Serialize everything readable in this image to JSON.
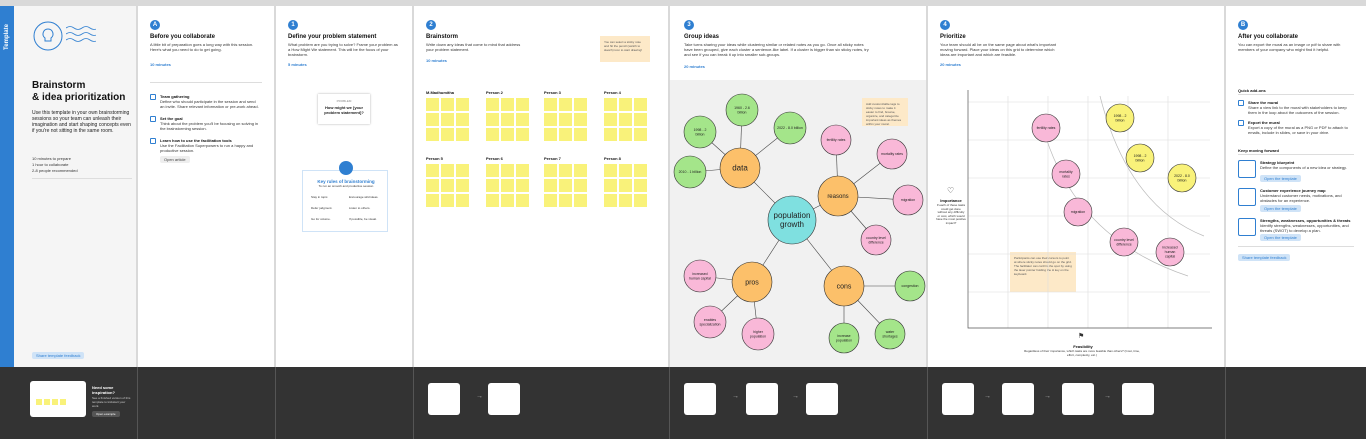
{
  "template_tab": "Template",
  "intro": {
    "title_line1": "Brainstorm",
    "title_line2": "& idea prioritization",
    "description": "Use this template in your own brainstorming sessions so your team can unleash their imagination and start shaping concepts even if you're not sitting in the same room.",
    "stats": [
      "10 minutes to prepare",
      "1 hour to collaborate",
      "2-8 people recommended"
    ],
    "feedback": "Share template feedback"
  },
  "before": {
    "step": "A",
    "title": "Before you collaborate",
    "text": "A little bit of preparation goes a long way with this session. Here's what you need to do to get going.",
    "time": "10 minutes",
    "items": [
      {
        "title": "Team gathering",
        "text": "Define who should participate in the session and send an invite. Share relevant information or pre-work ahead."
      },
      {
        "title": "Set the goal",
        "text": "Think about the problem you'll be focusing on solving in the brainstorming session."
      },
      {
        "title": "Learn how to use the facilitation tools",
        "text": "Use the Facilitation Superpowers to run a happy and productive session."
      }
    ],
    "open_article": "Open article"
  },
  "define": {
    "step": "1",
    "title": "Define your problem statement",
    "text": "What problem are you trying to solve? Frame your problem as a How Might We statement. This will be the focus of your brainstorm.",
    "time": "5 minutes",
    "card_label": "PROBLEM",
    "card_text": "How might we [your problem statement]?",
    "rules_title": "Key rules of brainstorming",
    "rules_sub": "To run an smooth and productive session",
    "rules": [
      "Stay in topic.",
      "Encourage wild ideas.",
      "Defer judgment.",
      "Listen to others.",
      "Go for volume.",
      "If possible, be visual."
    ]
  },
  "brainstorm": {
    "step": "2",
    "title": "Brainstorm",
    "text": "Write down any ideas that come to mind that address your problem statement.",
    "time": "10 minutes",
    "tip": "You can select a sticky note and hit the pencil (switch to sketch) icon to start drawing!",
    "people": [
      "M.Madhumitha",
      "Person 2",
      "Person 3",
      "Person 4",
      "Person 5",
      "Person 6",
      "Person 7",
      "Person 8"
    ]
  },
  "group": {
    "step": "3",
    "title": "Group ideas",
    "text": "Take turns sharing your ideas while clustering similar or related notes as you go. Once all sticky notes have been grouped, give each cluster a sentence-like label. If a cluster is bigger than six sticky notes, try and see if you can break it up into smaller sub-groups.",
    "time": "20 minutes",
    "tip": "Add customizable tags to sticky notes to make it easier to find, browse, organize, and categorize important ideas as themes within your mural.",
    "center": [
      "population",
      "growth"
    ],
    "clusters": {
      "data": "data",
      "reasons": "reasons",
      "pros": "pros",
      "cons": "cons"
    },
    "data_items": [
      [
        "1998 - 2",
        "billion"
      ],
      [
        "1960 - 2.6",
        "billion"
      ],
      [
        "2022 - 8.0 billion"
      ],
      [
        "2010 - 1 billion"
      ]
    ],
    "reason_items": [
      [
        "fertility rates"
      ],
      [
        "mortality rates"
      ],
      [
        "migration"
      ],
      [
        "country level",
        "difference"
      ]
    ],
    "pro_items": [
      [
        "increased",
        "human capital"
      ],
      [
        "enables",
        "specialization"
      ],
      [
        "higher",
        "population"
      ]
    ],
    "con_items": [
      [
        "congestion"
      ],
      [
        "water",
        "shortages"
      ],
      [
        "increase",
        "population"
      ]
    ]
  },
  "prioritize": {
    "step": "4",
    "title": "Prioritize",
    "text": "Your team should all be on the same page about what's important moving forward. Place your ideas on this grid to determine which ideas are important and which are feasible.",
    "time": "20 minutes",
    "y_label": "Importance",
    "y_text": "If each of these tasks could get done without any difficulty or cost, which would have the most positive impact?",
    "x_label": "Feasibility",
    "x_text": "Regardless of their importance, which tasks are more feasible than others? (Cost, time, effort, complexity, etc.)",
    "tip": "Participants can use their cursors to point at where sticky notes should go on the grid. The facilitator can confirm the spot by using the laser pointer holding the H key on the keyboard.",
    "items": [
      [
        "fertility rates"
      ],
      [
        "1998 - 2",
        "billion"
      ],
      [
        "mortality",
        "rates"
      ],
      [
        "1998 - 2",
        "billion"
      ],
      [
        "2022 - 8.0",
        "billion"
      ],
      [
        "migration"
      ],
      [
        "country level",
        "difference"
      ],
      [
        "increased",
        "human",
        "capital"
      ]
    ]
  },
  "after": {
    "title": "After you collaborate",
    "text": "You can export the mural as an image or pdf to share with members of your company who might find it helpful.",
    "quick_title": "Quick add-ons",
    "quick": [
      {
        "title": "Share the mural",
        "text": "Share a view link to the mural with stakeholders to keep them in the loop about the outcomes of the session."
      },
      {
        "title": "Export the mural",
        "text": "Export a copy of the mural as a PNG or PDF to attach to emails, include in slides, or save in your drive."
      }
    ],
    "keep_title": "Keep moving forward",
    "keep": [
      {
        "title": "Strategy blueprint",
        "text": "Define the components of a new idea or strategy.",
        "link": "Open the template"
      },
      {
        "title": "Customer experience journey map",
        "text": "Understand customer needs, motivations, and obstacles for an experience.",
        "link": "Open the template"
      },
      {
        "title": "Strengths, weaknesses, opportunities & threats",
        "text": "Identify strengths, weaknesses, opportunities, and threats (SWOT) to develop a plan.",
        "link": "Open the template"
      }
    ],
    "feedback": "Share template feedback"
  },
  "bottom": {
    "inspired_title": "Need some inspiration?",
    "inspired_text": "See a finished version of this template to kickstart your work.",
    "open_example": "Open example"
  },
  "colors": {
    "blue": "#2f7fd1",
    "yellow": "#f9f27a",
    "pink": "#f9b8d8",
    "green": "#a4e58a",
    "orange": "#fcc06a",
    "teal": "#7fe0e0"
  }
}
